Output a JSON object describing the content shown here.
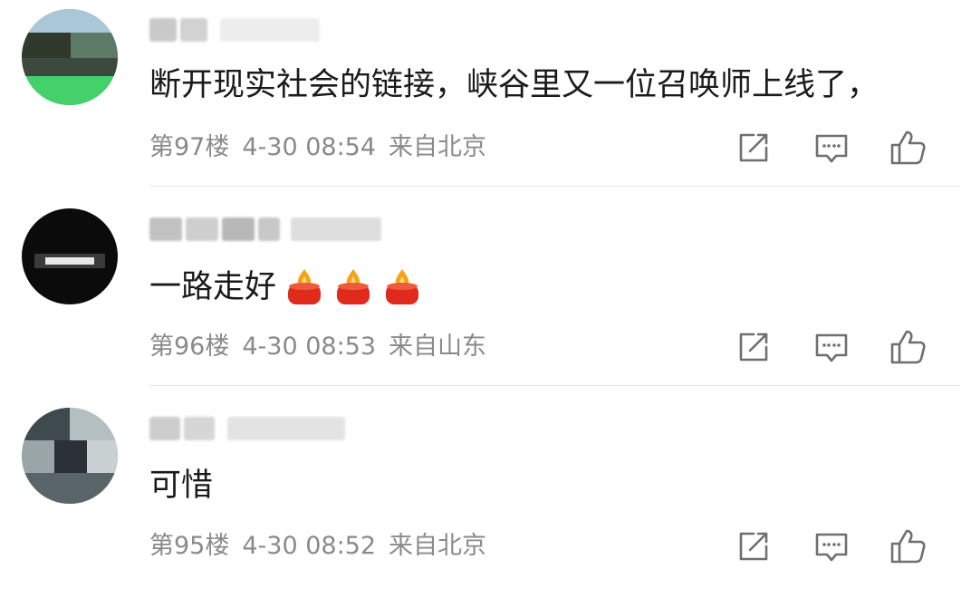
{
  "comments": [
    {
      "content": "断开现实社会的链接，峡谷里又一位召唤师上线了，",
      "floor": "第97楼",
      "time": "4-30 08:54",
      "location": "来自北京",
      "avatar_colors": [
        "#2f3a2c",
        "#5d7a66",
        "#44d06a",
        "#8fb8a3"
      ]
    },
    {
      "content": "一路走好",
      "candles": 3,
      "floor": "第96楼",
      "time": "4-30 08:53",
      "location": "来自山东",
      "avatar_colors": [
        "#0b0b0b",
        "#1c1c1c",
        "#3a3a3a",
        "#e8e8e8"
      ]
    },
    {
      "content": "可惜",
      "floor": "第95楼",
      "time": "4-30 08:52",
      "location": "来自北京",
      "avatar_colors": [
        "#3f4a4f",
        "#7f8a8e",
        "#b4bfc2",
        "#2b3136"
      ]
    }
  ],
  "actions": [
    "share-icon",
    "reply-icon",
    "like-icon"
  ],
  "colors": {
    "text": "#1a1a1a",
    "meta": "#8a8a8a",
    "icon": "#6f6f6f",
    "divider": "#e6e6e6",
    "candle_body": "#e02a1b",
    "candle_flame": "#f6a21a"
  }
}
